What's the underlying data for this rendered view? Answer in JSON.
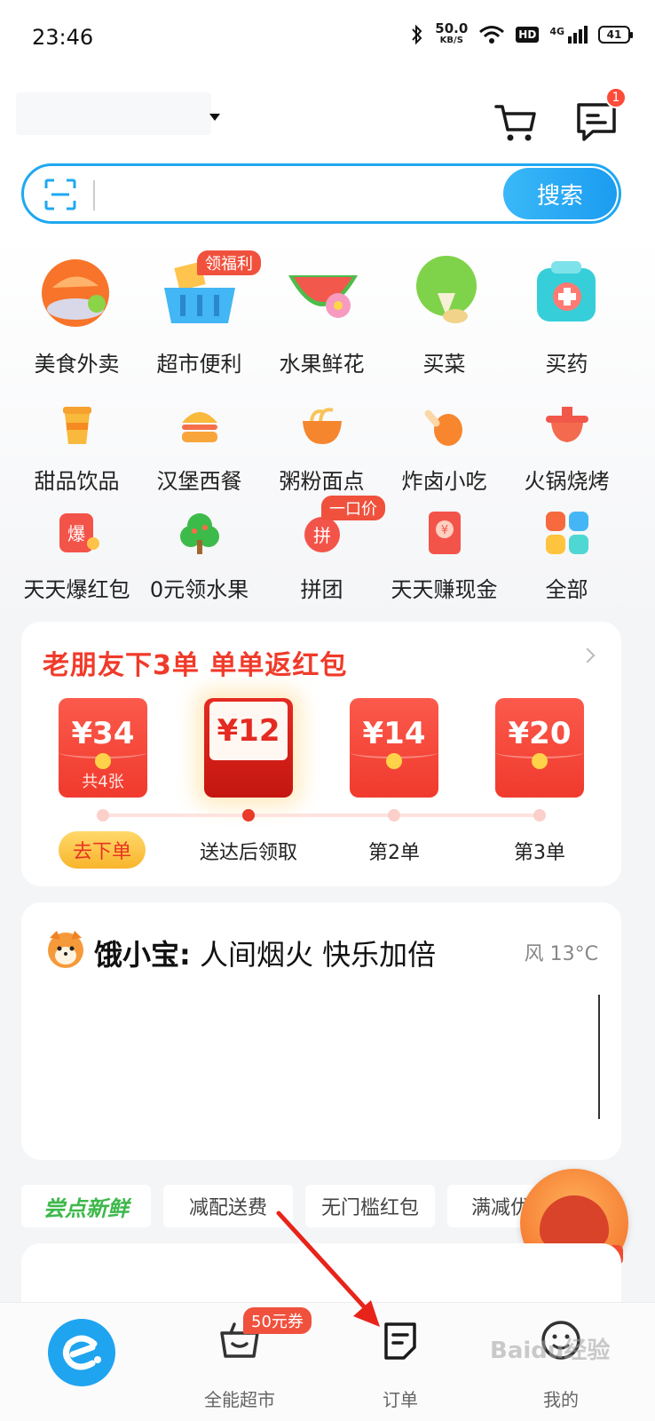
{
  "status_bar": {
    "time": "23:46",
    "net_speed": "50.0",
    "net_unit": "KB/S",
    "hd": "HD",
    "network": "4G",
    "battery": "41"
  },
  "header": {
    "message_badge": "1"
  },
  "search": {
    "placeholder": "",
    "button": "搜索"
  },
  "categories_big": [
    {
      "label": "美食外卖",
      "icon": "food-delivery-icon"
    },
    {
      "label": "超市便利",
      "icon": "supermarket-basket-icon",
      "tag": "领福利"
    },
    {
      "label": "水果鲜花",
      "icon": "watermelon-flower-icon"
    },
    {
      "label": "买菜",
      "icon": "vegetable-icon"
    },
    {
      "label": "买药",
      "icon": "medicine-box-icon"
    }
  ],
  "categories_small": [
    {
      "label": "甜品饮品",
      "icon": "drink-cup-icon"
    },
    {
      "label": "汉堡西餐",
      "icon": "burger-icon"
    },
    {
      "label": "粥粉面点",
      "icon": "noodle-bowl-icon"
    },
    {
      "label": "炸卤小吃",
      "icon": "chicken-leg-icon"
    },
    {
      "label": "火锅烧烤",
      "icon": "hotpot-icon"
    },
    {
      "label": "天天爆红包",
      "icon": "red-packet-burst-icon"
    },
    {
      "label": "0元领水果",
      "icon": "fruit-tree-icon"
    },
    {
      "label": "拼团",
      "icon": "group-buy-icon",
      "tag": "一口价"
    },
    {
      "label": "天天赚现金",
      "icon": "cash-envelope-icon"
    },
    {
      "label": "全部",
      "icon": "all-grid-icon"
    }
  ],
  "promo": {
    "title": "老朋友下3单 单单返红包",
    "envelopes": [
      {
        "amount": "¥34",
        "sub": "共4张"
      },
      {
        "amount": "¥12",
        "sub": ""
      },
      {
        "amount": "¥14",
        "sub": ""
      },
      {
        "amount": "¥20",
        "sub": ""
      }
    ],
    "steps": [
      "去下单",
      "送达后领取",
      "第2单",
      "第3单"
    ]
  },
  "mascot": {
    "name": "饿小宝:",
    "slogan": "人间烟火 快乐加倍",
    "weather": "风 13°C"
  },
  "filters": [
    "尝点新鲜",
    "减配送费",
    "无门槛红包",
    "满减优"
  ],
  "tabbar": {
    "items": [
      {
        "label": "",
        "icon": "eleme-home-icon"
      },
      {
        "label": "全能超市",
        "icon": "basket-smile-icon",
        "tag": "50元券"
      },
      {
        "label": "订单",
        "icon": "order-note-icon"
      },
      {
        "label": "我的",
        "icon": "smile-face-icon"
      }
    ]
  },
  "colors": {
    "brand_blue": "#1FA8F0",
    "promo_red": "#F03A2A",
    "tag_red": "#F0513D",
    "fresh_green": "#3DB84A"
  },
  "watermark": "Baidu经验"
}
